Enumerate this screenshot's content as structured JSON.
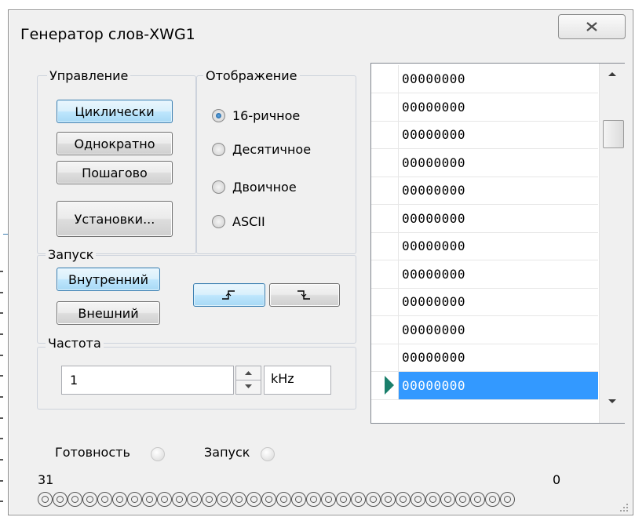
{
  "window": {
    "title": "Генератор слов-XWG1"
  },
  "control": {
    "legend": "Управление",
    "cyclic": "Циклически",
    "single": "Однократно",
    "step": "Пошагово",
    "settings": "Установки..."
  },
  "display": {
    "legend": "Отображение",
    "options": [
      "16-ричное",
      "Десятичное",
      "Двоичное",
      "ASCII"
    ],
    "selected": "16-ричное"
  },
  "trigger": {
    "legend": "Запуск",
    "internal": "Внутренний",
    "external": "Внешний"
  },
  "frequency": {
    "legend": "Частота",
    "value": "1",
    "unit": "kHz"
  },
  "words": [
    "00000000",
    "00000000",
    "00000000",
    "00000000",
    "00000000",
    "00000000",
    "00000000",
    "00000000",
    "00000000",
    "00000000",
    "00000000",
    "00000000"
  ],
  "selected_row_index": 11,
  "status": {
    "ready": "Готовность",
    "trigger": "Запуск"
  },
  "bits": {
    "high": "31",
    "low": "0",
    "count": 32
  },
  "colors": {
    "selection": "#3399ff",
    "active_button": "#bee6fd",
    "cursor": "#1a7f6b"
  }
}
